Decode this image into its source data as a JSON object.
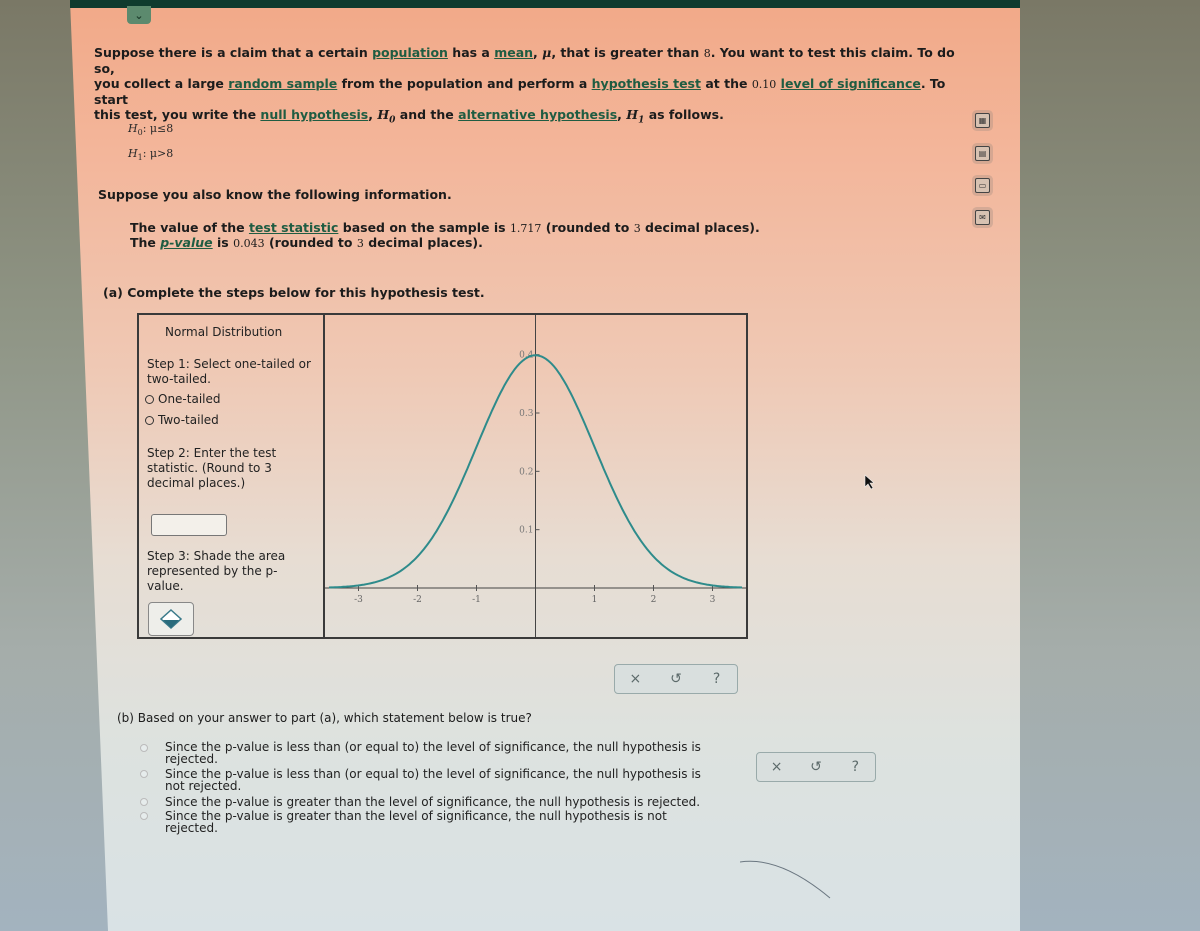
{
  "header": {
    "collapse_glyph": "⌄"
  },
  "intro": {
    "line1_a": "Suppose there is a claim that a certain ",
    "link_population": "population",
    "line1_b": " has a ",
    "link_mean": "mean",
    "line1_c": ", ",
    "mu": "μ",
    "line1_d": ", that is greater than ",
    "claim_value": "8",
    "line1_e": ". You want to test this claim. To do so,",
    "line2_a": "you collect a large ",
    "link_random_sample": "random sample",
    "line2_b": " from the population and perform a ",
    "link_hypothesis_test": "hypothesis test",
    "line2_c": " at the ",
    "significance": "0.10",
    "line2_d": " ",
    "link_level_of_significance": "level of significance",
    "line2_e": ". To start",
    "line3_a": "this test, you write the ",
    "link_null_hypothesis": "null hypothesis",
    "line3_b": ", ",
    "h0_sym": "H",
    "h0_sub": "0",
    "line3_c": " and the ",
    "link_alternative_hypothesis": "alternative hypothesis",
    "line3_d": ", ",
    "h1_sym": "H",
    "h1_sub": "1",
    "line3_e": " as follows."
  },
  "hypotheses": {
    "h0": {
      "sym": "H",
      "sub": "0",
      "expr": ": μ≤8"
    },
    "h1": {
      "sym": "H",
      "sub": "1",
      "expr": ": μ>8"
    }
  },
  "info": {
    "heading": "Suppose you also know the following information.",
    "ts_a": "The value of the ",
    "link_test_statistic": "test statistic",
    "ts_b": " based on the sample is ",
    "test_statistic": "1.717",
    "ts_c": " (rounded to ",
    "ts_places": "3",
    "ts_d": " decimal places).",
    "pv_a": "The ",
    "link_p_value": "p-value",
    "pv_b": " is ",
    "p_value": "0.043",
    "pv_c": " (rounded to ",
    "pv_places": "3",
    "pv_d": " decimal places)."
  },
  "part_a": {
    "prompt": "(a) Complete the steps below for this hypothesis test.",
    "widget": {
      "title": "Normal Distribution",
      "step1": "Step 1: Select one-tailed or two-tailed.",
      "options": [
        "One-tailed",
        "Two-tailed"
      ],
      "step2": "Step 2: Enter the test statistic. (Round to 3 decimal places.)",
      "test_statistic_input": "",
      "step3": "Step 3: Shade the area represented by the p-value."
    },
    "actions": {
      "clear": "×",
      "undo": "↺",
      "help": "?"
    }
  },
  "chart_data": {
    "type": "line",
    "title": "",
    "series": [
      {
        "name": "standard normal pdf",
        "function": "N(0,1)"
      }
    ],
    "xlim": [
      -3.5,
      3.5
    ],
    "ylim": [
      0,
      0.42
    ],
    "xticks": [
      "-3",
      "-2",
      "-1",
      "1",
      "2",
      "3"
    ],
    "yticks": [
      "0.1",
      "0.2",
      "0.3",
      "0.4"
    ],
    "line_color": "#2e8b8b",
    "grid": false
  },
  "part_b": {
    "prompt": "(b) Based on your answer to part (a), which statement below is true?",
    "options": [
      {
        "l1": "Since the p-value is less than (or equal to) the level of significance, the null hypothesis is",
        "l2": "rejected."
      },
      {
        "l1": "Since the p-value is less than (or equal to) the level of significance, the null hypothesis is",
        "l2": "not rejected."
      },
      {
        "l1": "Since the p-value is greater than the level of significance, the null hypothesis is rejected.",
        "l2": ""
      },
      {
        "l1": "Since the p-value is greater than the level of significance, the null hypothesis is not",
        "l2": "rejected."
      }
    ],
    "actions": {
      "clear": "×",
      "undo": "↺",
      "help": "?"
    }
  },
  "side_tools": [
    "calculator-icon",
    "table-icon",
    "chart-icon",
    "mail-icon"
  ]
}
